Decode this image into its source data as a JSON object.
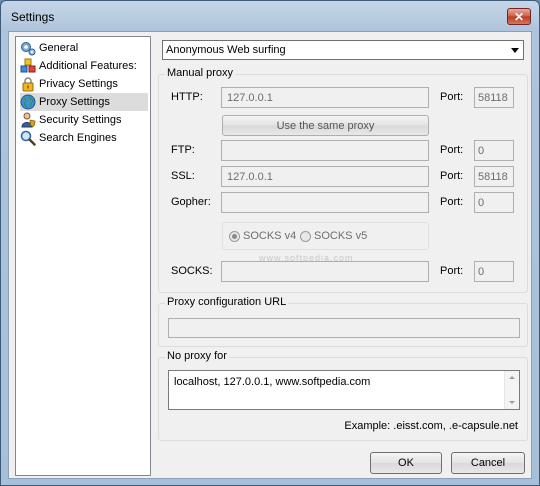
{
  "window": {
    "title": "Settings",
    "close_glyph": "✕"
  },
  "sidebar": {
    "items": [
      {
        "label": "General",
        "icon": "gears-icon"
      },
      {
        "label": "Additional Features:",
        "icon": "blocks-icon"
      },
      {
        "label": "Privacy Settings",
        "icon": "lock-icon"
      },
      {
        "label": "Proxy Settings",
        "icon": "globe-icon",
        "selected": true
      },
      {
        "label": "Security Settings",
        "icon": "user-shield-icon"
      },
      {
        "label": "Search Engines",
        "icon": "magnifier-icon"
      }
    ]
  },
  "mode_select": {
    "value": "Anonymous Web surfing"
  },
  "manual_proxy": {
    "caption": "Manual proxy",
    "http": {
      "label": "HTTP:",
      "value": "127.0.0.1",
      "port_label": "Port:",
      "port": "58118"
    },
    "same_proxy_label": "Use the same proxy",
    "ftp": {
      "label": "FTP:",
      "value": "",
      "port_label": "Port:",
      "port": "0"
    },
    "ssl": {
      "label": "SSL:",
      "value": "127.0.0.1",
      "port_label": "Port:",
      "port": "58118"
    },
    "gopher": {
      "label": "Gopher:",
      "value": "",
      "port_label": "Port:",
      "port": "0"
    },
    "socks_v4_label": "SOCKS v4",
    "socks_v5_label": "SOCKS v5",
    "socks": {
      "label": "SOCKS:",
      "value": "",
      "port_label": "Port:",
      "port": "0"
    },
    "watermark": "www.softpedia.com"
  },
  "proxy_config_url": {
    "caption": "Proxy configuration URL",
    "value": ""
  },
  "no_proxy": {
    "caption": "No proxy for",
    "value": "localhost, 127.0.0.1, www.softpedia.com",
    "example": "Example: .eisst.com, .e-capsule.net"
  },
  "buttons": {
    "ok": "OK",
    "cancel": "Cancel"
  }
}
